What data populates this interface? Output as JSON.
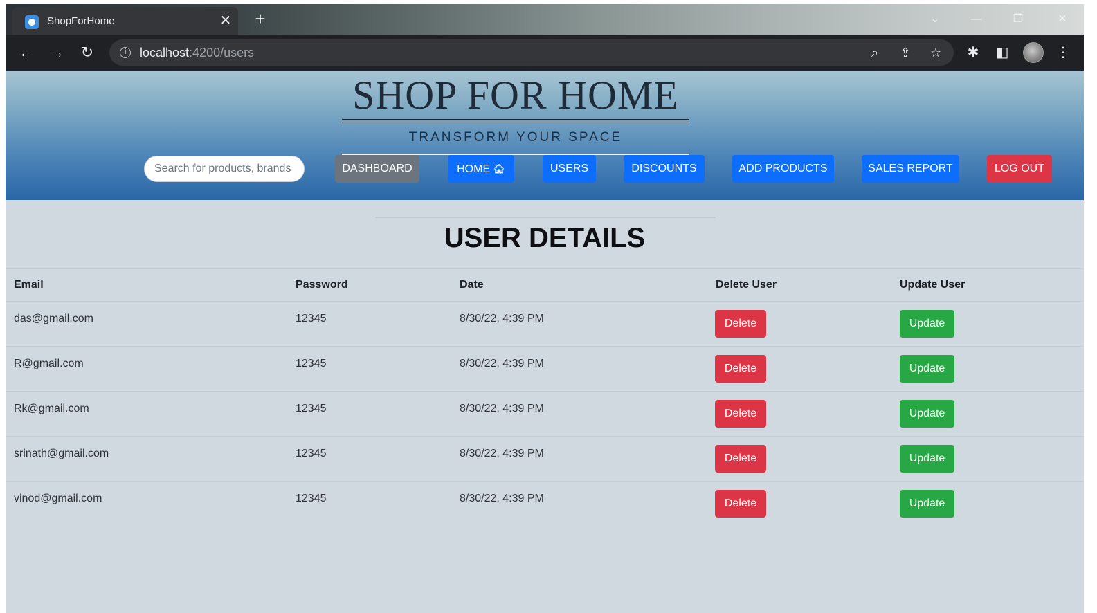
{
  "browser": {
    "tab_title": "ShopForHome",
    "tab_close": "✕",
    "new_tab": "+",
    "url_host": "localhost",
    "url_path": ":4200/users"
  },
  "header": {
    "brand_title": "SHOP FOR HOME",
    "tagline": "TRANSFORM YOUR SPACE",
    "search_placeholder": "Search for products, brands",
    "nav": {
      "dashboard": "DASHBOARD",
      "home": "HOME",
      "users": "USERS",
      "discounts": "DISCOUNTS",
      "add_products": "ADD PRODUCTS",
      "sales_report": "SALES REPORT",
      "logout": "LOG OUT"
    }
  },
  "main": {
    "title": "USER DETAILS",
    "columns": {
      "email": "Email",
      "password": "Password",
      "date": "Date",
      "delete_user": "Delete User",
      "update_user": "Update User"
    },
    "delete_label": "Delete",
    "update_label": "Update",
    "users": [
      {
        "email": "das@gmail.com",
        "password": "12345",
        "date": "8/30/22, 4:39 PM"
      },
      {
        "email": "R@gmail.com",
        "password": "12345",
        "date": "8/30/22, 4:39 PM"
      },
      {
        "email": "Rk@gmail.com",
        "password": "12345",
        "date": "8/30/22, 4:39 PM"
      },
      {
        "email": "srinath@gmail.com",
        "password": "12345",
        "date": "8/30/22, 4:39 PM"
      },
      {
        "email": "vinod@gmail.com",
        "password": "12345",
        "date": "8/30/22, 4:39 PM"
      }
    ]
  },
  "colors": {
    "primary": "#0d6efd",
    "secondary": "#6c757d",
    "danger": "#dc3545",
    "success": "#28a745",
    "page_background": "#d1d9e0"
  }
}
